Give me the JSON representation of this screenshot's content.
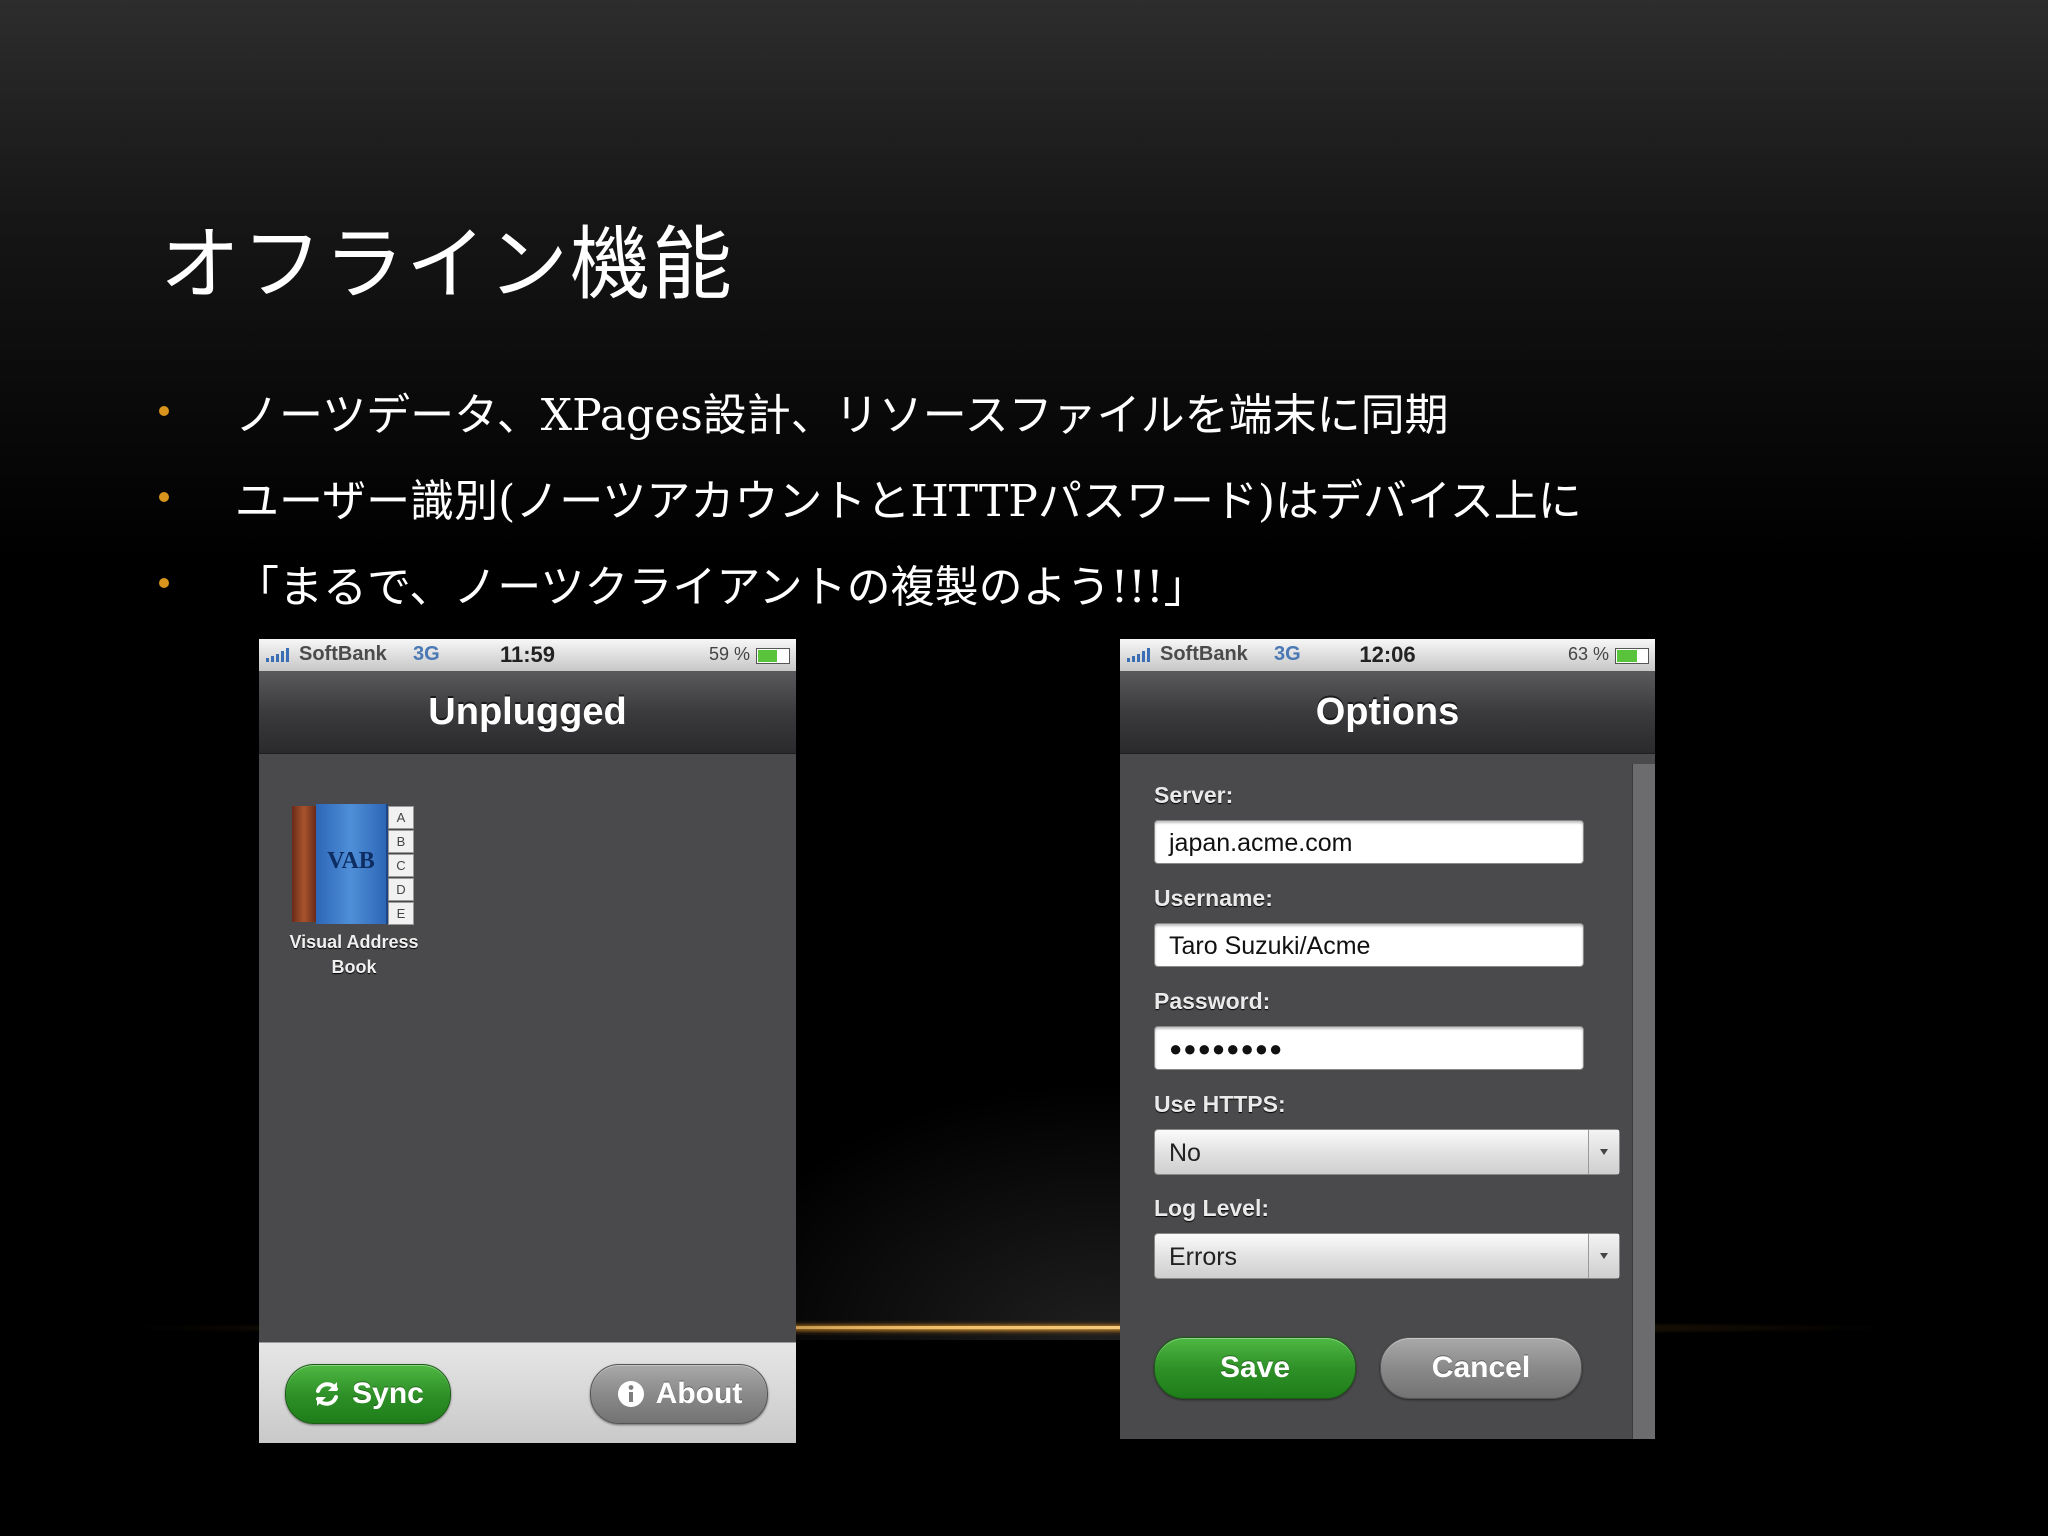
{
  "slide": {
    "title": "オフライン機能",
    "bullets": [
      "ノーツデータ、XPages設計、リソースファイルを端末に同期",
      "ユーザー識別(ノーツアカウントとHTTPパスワード)はデバイス上に",
      "「まるで、ノーツクライアントの複製のよう!!!」"
    ]
  },
  "colors": {
    "bullet": "#d8941c",
    "green_button": "#2f9128",
    "gray_button": "#8a8a8a"
  },
  "phone_left": {
    "status": {
      "carrier": "SoftBank",
      "network": "3G",
      "time": "11:59",
      "battery": "59 %",
      "battery_level": 0.59
    },
    "nav_title": "Unplugged",
    "app": {
      "icon_text": "VAB",
      "tab_letters": [
        "A",
        "B",
        "C",
        "D",
        "E"
      ],
      "label_line1": "Visual Address",
      "label_line2": "Book",
      "icon": "book-icon"
    },
    "toolbar": {
      "sync_label": "Sync",
      "sync_icon": "refresh-icon",
      "about_label": "About",
      "about_icon": "info-icon"
    }
  },
  "phone_right": {
    "status": {
      "carrier": "SoftBank",
      "network": "3G",
      "time": "12:06",
      "battery": "63 %",
      "battery_level": 0.63
    },
    "nav_title": "Options",
    "form": {
      "server_label": "Server:",
      "server_value": "japan.acme.com",
      "username_label": "Username:",
      "username_value": "Taro Suzuki/Acme",
      "password_label": "Password:",
      "password_value": "●●●●●●●●",
      "https_label": "Use HTTPS:",
      "https_value": "No",
      "loglevel_label": "Log Level:",
      "loglevel_value": "Errors"
    },
    "buttons": {
      "save_label": "Save",
      "cancel_label": "Cancel"
    }
  }
}
